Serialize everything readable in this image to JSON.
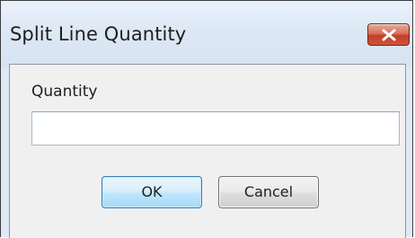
{
  "window": {
    "title": "Split Line Quantity"
  },
  "form": {
    "quantity_label": "Quantity",
    "quantity_value": ""
  },
  "buttons": {
    "ok_label": "OK",
    "cancel_label": "Cancel"
  },
  "icons": {
    "close": "close-icon"
  },
  "colors": {
    "close_button": "#c7442b",
    "ok_border": "#3c7fb1",
    "client_bg": "#f0f0f0"
  }
}
